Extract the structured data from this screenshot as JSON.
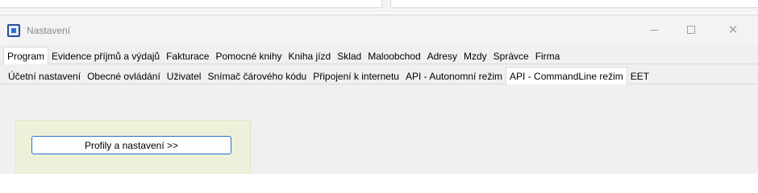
{
  "window": {
    "title": "Nastavení",
    "controls": {
      "minimize_icon": "minimize-icon",
      "maximize_icon": "maximize-icon",
      "close_icon": "close-icon"
    }
  },
  "tabs_row1": {
    "items": [
      {
        "label": "Program"
      },
      {
        "label": "Evidence příjmů a výdajů"
      },
      {
        "label": "Fakturace"
      },
      {
        "label": "Pomocné knihy"
      },
      {
        "label": "Kniha jízd"
      },
      {
        "label": "Sklad"
      },
      {
        "label": "Maloobchod"
      },
      {
        "label": "Adresy"
      },
      {
        "label": "Mzdy"
      },
      {
        "label": "Správce"
      },
      {
        "label": "Firma"
      }
    ],
    "active": "Program"
  },
  "tabs_row2": {
    "items": [
      {
        "label": "Účetní nastavení"
      },
      {
        "label": "Obecné ovládání"
      },
      {
        "label": "Uživatel"
      },
      {
        "label": "Snímač čárového kódu"
      },
      {
        "label": "Připojení k internetu"
      },
      {
        "label": "API - Autonomní režim"
      },
      {
        "label": "API - CommandLine režim"
      },
      {
        "label": "EET"
      }
    ],
    "active": "API - CommandLine režim"
  },
  "content": {
    "profiles_button_label": "Profily a nastavení >>",
    "panel_color": "#eef1d9",
    "button_border_color": "#2b6fd1"
  }
}
